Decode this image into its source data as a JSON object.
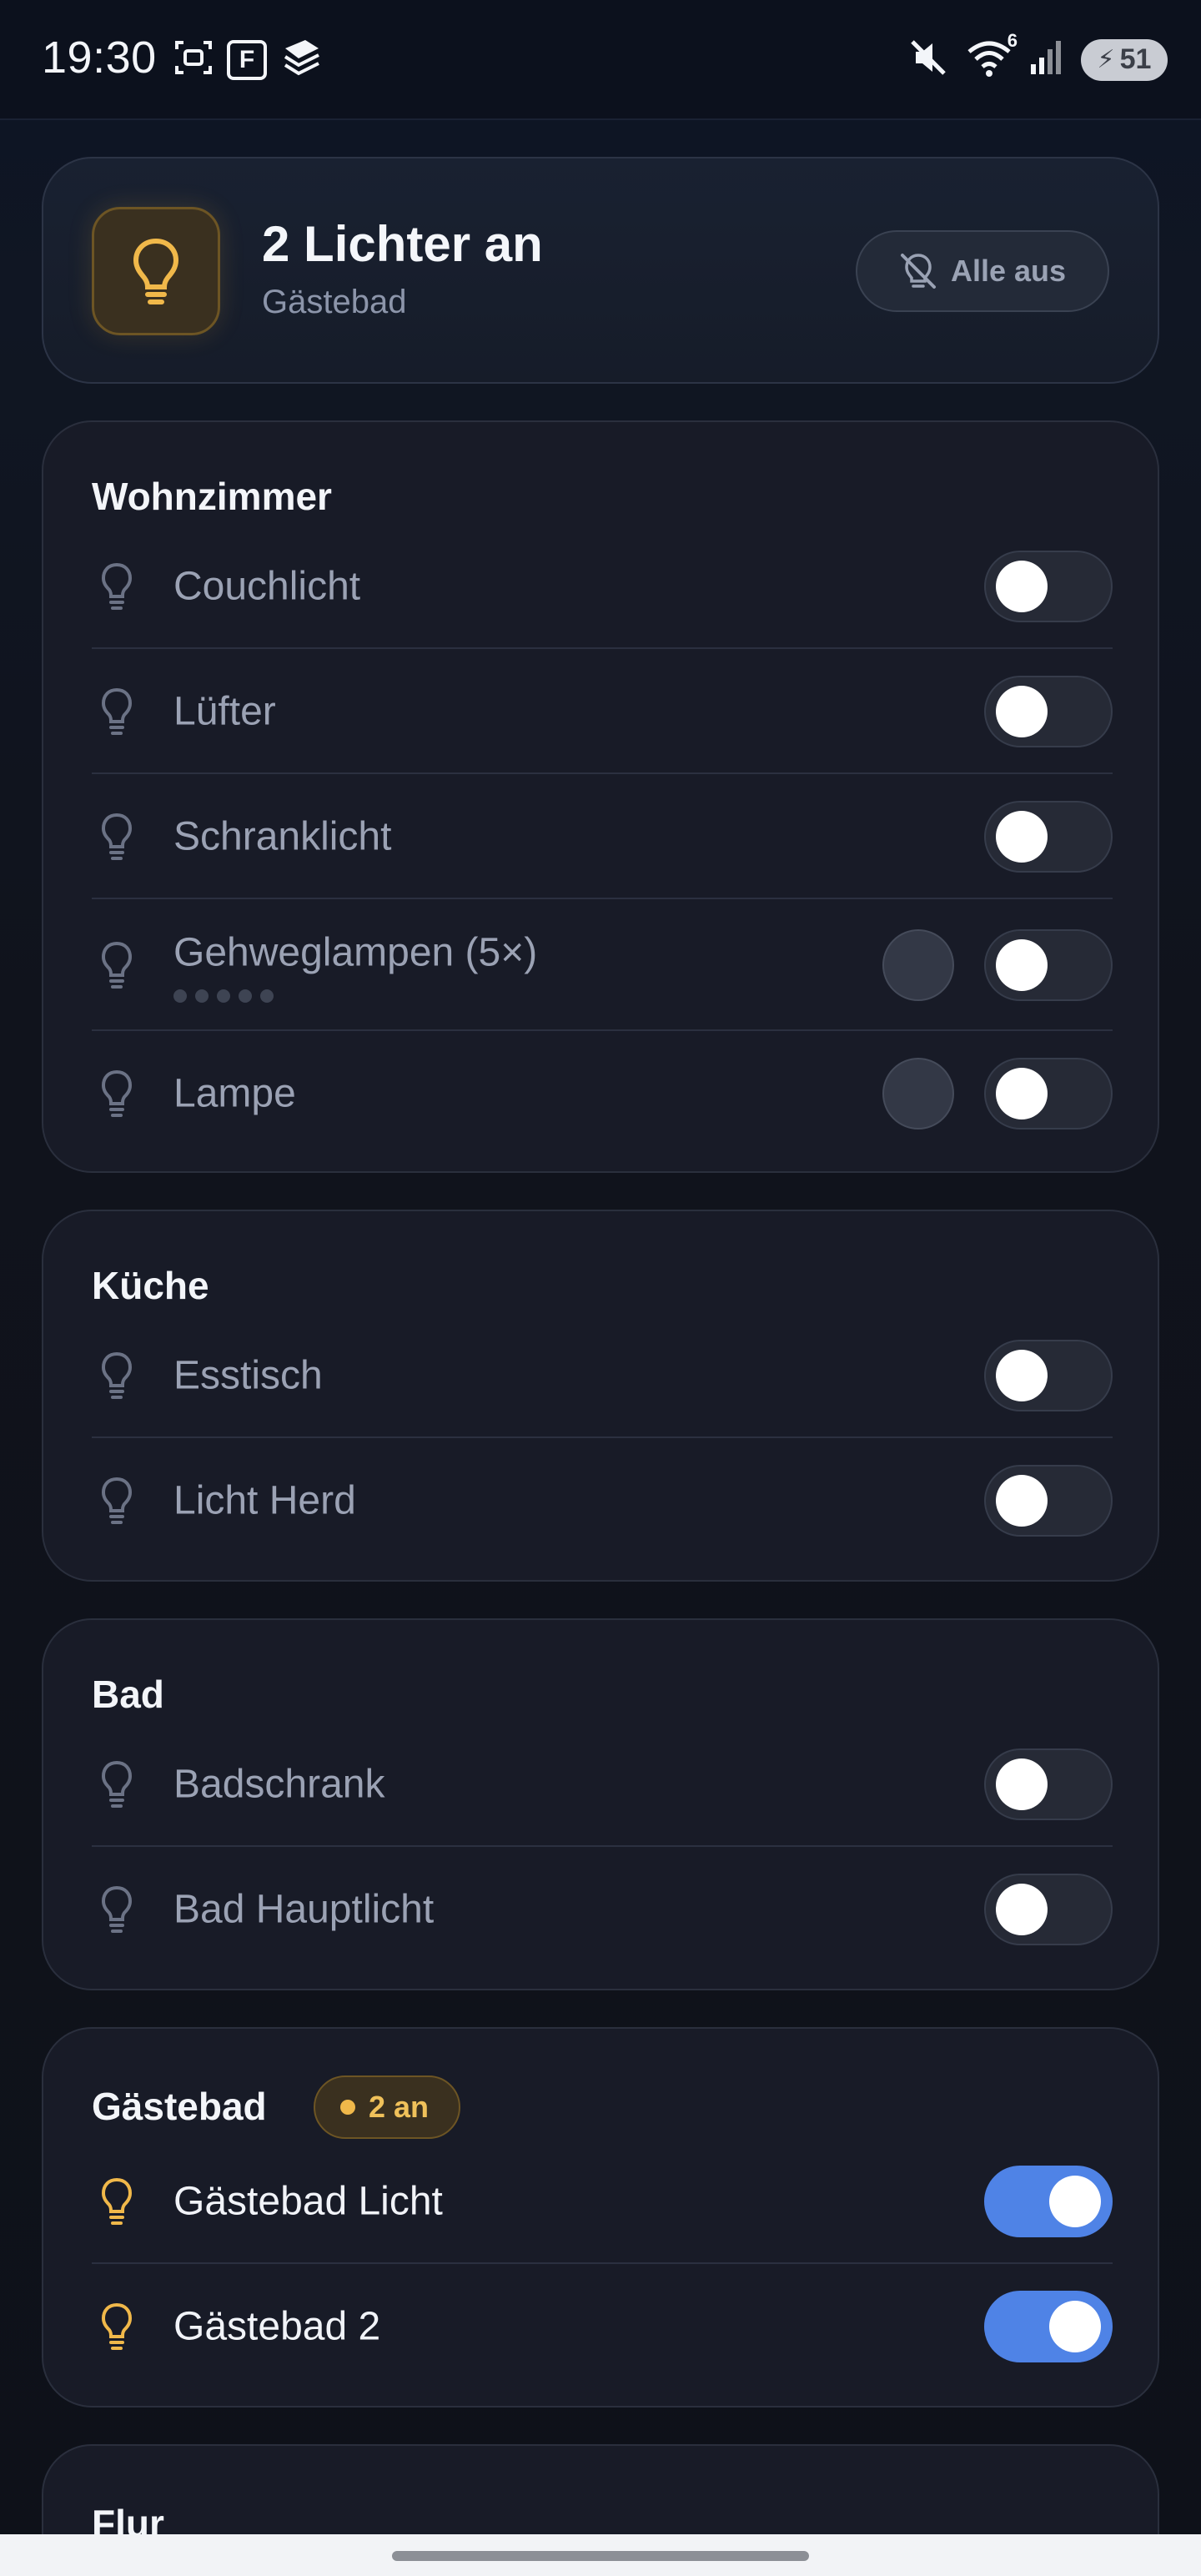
{
  "status_bar": {
    "time": "19:30",
    "icons_left": [
      "screenshot-icon",
      "f-app-icon",
      "layers-app-icon"
    ],
    "icons_right": [
      "mute-icon",
      "wifi-icon",
      "signal-icon"
    ],
    "wifi_badge": "6",
    "battery_level": "51"
  },
  "summary": {
    "title": "2 Lichter an",
    "subtitle": "Gästebad",
    "all_off_label": "Alle aus",
    "accent_color": "#f0b84a"
  },
  "rooms": [
    {
      "name": "Wohnzimmer",
      "lights": [
        {
          "label": "Couchlicht",
          "on": false
        },
        {
          "label": "Lüfter",
          "on": false
        },
        {
          "label": "Schranklicht",
          "on": false
        },
        {
          "label": "Gehweglampen (5×)",
          "on": false,
          "sub_lights": 5,
          "has_color": true
        },
        {
          "label": "Lampe",
          "on": false,
          "has_color": true
        }
      ]
    },
    {
      "name": "Küche",
      "lights": [
        {
          "label": "Esstisch",
          "on": false
        },
        {
          "label": "Licht Herd",
          "on": false
        }
      ]
    },
    {
      "name": "Bad",
      "lights": [
        {
          "label": "Badschrank",
          "on": false
        },
        {
          "label": "Bad Hauptlicht",
          "on": false
        }
      ]
    },
    {
      "name": "Gästebad",
      "badge": "2 an",
      "lights": [
        {
          "label": "Gästebad Licht",
          "on": true
        },
        {
          "label": "Gästebad 2",
          "on": true
        }
      ]
    },
    {
      "name": "Flur",
      "lights": []
    }
  ],
  "colors": {
    "toggle_on": "#4f83e6",
    "toggle_off": "#262a36",
    "bulb_on": "#f0b84a",
    "bulb_off": "#6b7285"
  }
}
